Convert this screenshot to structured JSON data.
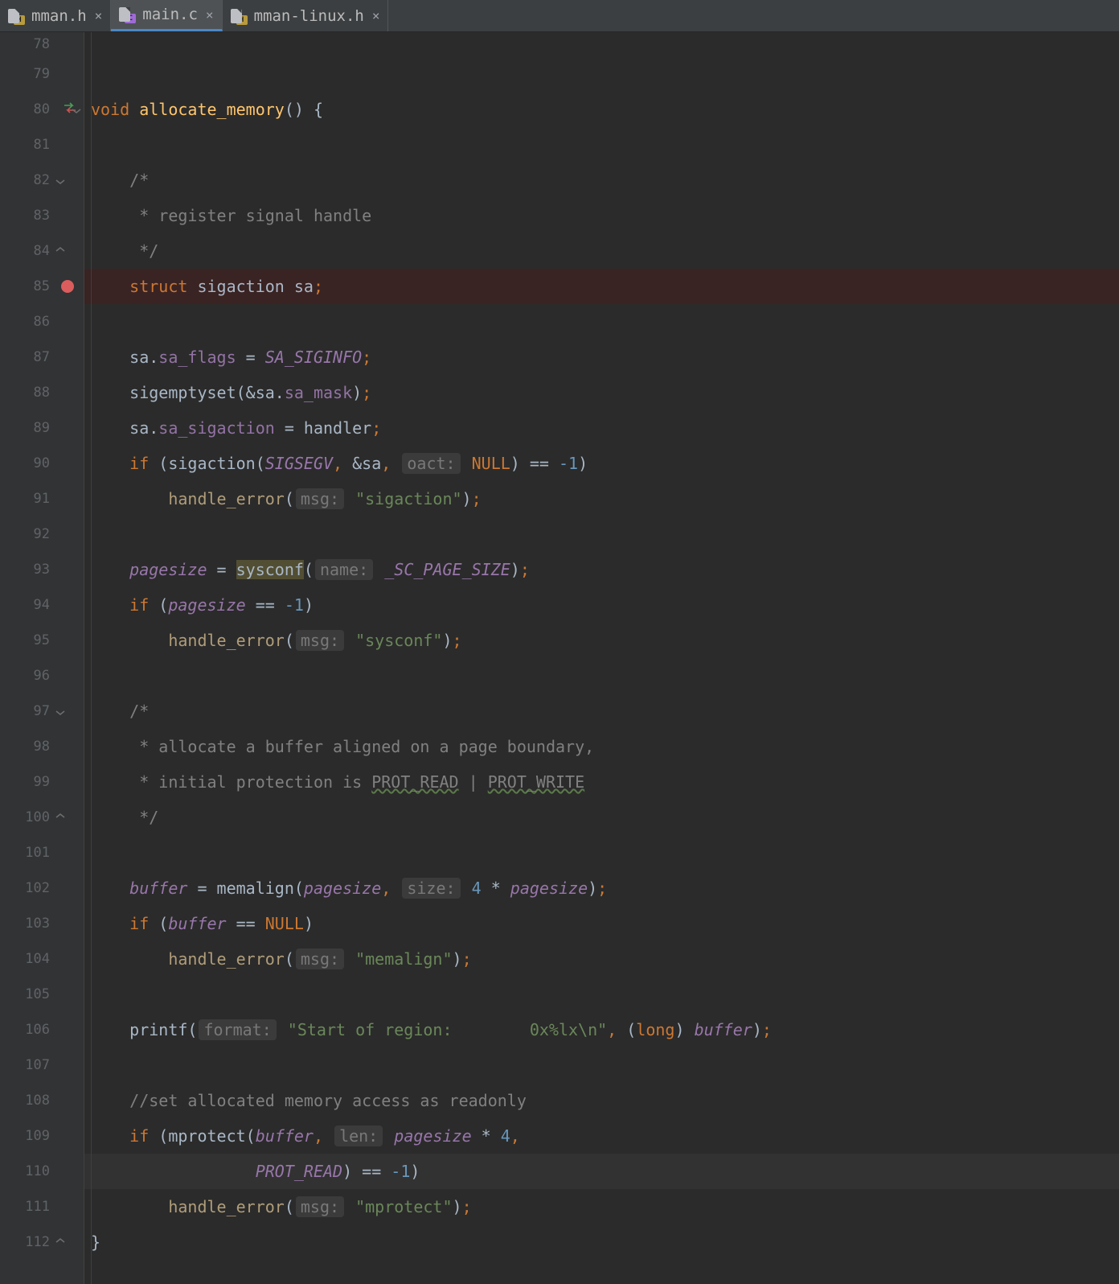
{
  "tabs": [
    {
      "label": "mman.h",
      "icon": "h",
      "active": false
    },
    {
      "label": "main.c",
      "icon": "c",
      "active": true
    },
    {
      "label": "mman-linux.h",
      "icon": "h",
      "active": false
    }
  ],
  "gutter": {
    "swap_line": 80,
    "breakpoint_line": 85,
    "fold_open_lines": [
      80,
      82,
      97
    ],
    "fold_close_lines": [
      84,
      100,
      112
    ]
  },
  "lines": [
    {
      "n": 78,
      "first": true,
      "tokens": []
    },
    {
      "n": 79,
      "tokens": []
    },
    {
      "n": 80,
      "tokens": [
        [
          "kw",
          "void "
        ],
        [
          "fn",
          "allocate_memory"
        ],
        [
          "id",
          "() {"
        ]
      ]
    },
    {
      "n": 81,
      "tokens": []
    },
    {
      "n": 82,
      "tokens": [
        [
          "id",
          "    "
        ],
        [
          "cm",
          "/*"
        ]
      ]
    },
    {
      "n": 83,
      "tokens": [
        [
          "id",
          "     "
        ],
        [
          "cm",
          "* register signal handle"
        ]
      ]
    },
    {
      "n": 84,
      "tokens": [
        [
          "id",
          "     "
        ],
        [
          "cm",
          "*/"
        ]
      ]
    },
    {
      "n": 85,
      "bp": true,
      "tokens": [
        [
          "id",
          "    "
        ],
        [
          "kw",
          "struct "
        ],
        [
          "id",
          "sigaction sa"
        ],
        [
          "kw",
          ";"
        ]
      ]
    },
    {
      "n": 86,
      "tokens": []
    },
    {
      "n": 87,
      "tokens": [
        [
          "id",
          "    sa."
        ],
        [
          "fd",
          "sa_flags"
        ],
        [
          "id",
          " = "
        ],
        [
          "mac",
          "SA_SIGINFO"
        ],
        [
          "kw",
          ";"
        ]
      ]
    },
    {
      "n": 88,
      "tokens": [
        [
          "id",
          "    sigemptyset(&sa."
        ],
        [
          "fd",
          "sa_mask"
        ],
        [
          "id",
          ")"
        ],
        [
          "kw",
          ";"
        ]
      ]
    },
    {
      "n": 89,
      "tokens": [
        [
          "id",
          "    sa."
        ],
        [
          "fd",
          "sa_sigaction"
        ],
        [
          "id",
          " = handler"
        ],
        [
          "kw",
          ";"
        ]
      ]
    },
    {
      "n": 90,
      "tokens": [
        [
          "id",
          "    "
        ],
        [
          "kw",
          "if "
        ],
        [
          "id",
          "(sigaction("
        ],
        [
          "mac",
          "SIGSEGV"
        ],
        [
          "kw",
          ", "
        ],
        [
          "id",
          "&sa"
        ],
        [
          "kw",
          ", "
        ],
        [
          "hint",
          "oact:"
        ],
        [
          "kw",
          " NULL"
        ],
        [
          "id",
          ") == "
        ],
        [
          "nm",
          "-1"
        ],
        [
          "id",
          ")"
        ]
      ]
    },
    {
      "n": 91,
      "tokens": [
        [
          "id",
          "        "
        ],
        [
          "fn2",
          "handle_error"
        ],
        [
          "id",
          "("
        ],
        [
          "hint",
          "msg:"
        ],
        [
          "id",
          " "
        ],
        [
          "st",
          "\"sigaction\""
        ],
        [
          "id",
          ")"
        ],
        [
          "kw",
          ";"
        ]
      ]
    },
    {
      "n": 92,
      "tokens": []
    },
    {
      "n": 93,
      "tokens": [
        [
          "id",
          "    "
        ],
        [
          "pu",
          "pagesize"
        ],
        [
          "id",
          " = "
        ],
        [
          "hi",
          "sysconf"
        ],
        [
          "id",
          "("
        ],
        [
          "hint",
          "name:"
        ],
        [
          "id",
          " "
        ],
        [
          "mac",
          "_SC_PAGE_SIZE"
        ],
        [
          "id",
          ")"
        ],
        [
          "kw",
          ";"
        ]
      ]
    },
    {
      "n": 94,
      "tokens": [
        [
          "id",
          "    "
        ],
        [
          "kw",
          "if "
        ],
        [
          "id",
          "("
        ],
        [
          "pu",
          "pagesize"
        ],
        [
          "id",
          " == "
        ],
        [
          "nm",
          "-1"
        ],
        [
          "id",
          ")"
        ]
      ]
    },
    {
      "n": 95,
      "tokens": [
        [
          "id",
          "        "
        ],
        [
          "fn2",
          "handle_error"
        ],
        [
          "id",
          "("
        ],
        [
          "hint",
          "msg:"
        ],
        [
          "id",
          " "
        ],
        [
          "st",
          "\"sysconf\""
        ],
        [
          "id",
          ")"
        ],
        [
          "kw",
          ";"
        ]
      ]
    },
    {
      "n": 96,
      "tokens": []
    },
    {
      "n": 97,
      "tokens": [
        [
          "id",
          "    "
        ],
        [
          "cm",
          "/*"
        ]
      ]
    },
    {
      "n": 98,
      "tokens": [
        [
          "id",
          "     "
        ],
        [
          "cm",
          "* allocate a buffer aligned on a page boundary,"
        ]
      ]
    },
    {
      "n": 99,
      "tokens": [
        [
          "id",
          "     "
        ],
        [
          "cm",
          "* initial protection is "
        ],
        [
          "ulcm",
          "PROT_READ"
        ],
        [
          "cm",
          " | "
        ],
        [
          "ulcm",
          "PROT_WRITE"
        ]
      ]
    },
    {
      "n": 100,
      "tokens": [
        [
          "id",
          "     "
        ],
        [
          "cm",
          "*/"
        ]
      ]
    },
    {
      "n": 101,
      "tokens": []
    },
    {
      "n": 102,
      "tokens": [
        [
          "id",
          "    "
        ],
        [
          "pu",
          "buffer"
        ],
        [
          "id",
          " = memalign("
        ],
        [
          "pu",
          "pagesize"
        ],
        [
          "kw",
          ", "
        ],
        [
          "hint",
          "size:"
        ],
        [
          "id",
          " "
        ],
        [
          "nm",
          "4"
        ],
        [
          "id",
          " * "
        ],
        [
          "pu",
          "pagesize"
        ],
        [
          "id",
          ")"
        ],
        [
          "kw",
          ";"
        ]
      ]
    },
    {
      "n": 103,
      "tokens": [
        [
          "id",
          "    "
        ],
        [
          "kw",
          "if "
        ],
        [
          "id",
          "("
        ],
        [
          "pu",
          "buffer"
        ],
        [
          "id",
          " == "
        ],
        [
          "kw",
          "NULL"
        ],
        [
          "id",
          ")"
        ]
      ]
    },
    {
      "n": 104,
      "tokens": [
        [
          "id",
          "        "
        ],
        [
          "fn2",
          "handle_error"
        ],
        [
          "id",
          "("
        ],
        [
          "hint",
          "msg:"
        ],
        [
          "id",
          " "
        ],
        [
          "st",
          "\"memalign\""
        ],
        [
          "id",
          ")"
        ],
        [
          "kw",
          ";"
        ]
      ]
    },
    {
      "n": 105,
      "tokens": []
    },
    {
      "n": 106,
      "tokens": [
        [
          "id",
          "    printf("
        ],
        [
          "hint",
          "format:"
        ],
        [
          "id",
          " "
        ],
        [
          "st",
          "\"Start of region:        0x%lx\\n\""
        ],
        [
          "kw",
          ", "
        ],
        [
          "id",
          "("
        ],
        [
          "kw",
          "long"
        ],
        [
          "id",
          ") "
        ],
        [
          "pu",
          "buffer"
        ],
        [
          "id",
          ")"
        ],
        [
          "kw",
          ";"
        ]
      ]
    },
    {
      "n": 107,
      "tokens": []
    },
    {
      "n": 108,
      "tokens": [
        [
          "id",
          "    "
        ],
        [
          "cm",
          "//set allocated memory access as readonly"
        ]
      ]
    },
    {
      "n": 109,
      "tokens": [
        [
          "id",
          "    "
        ],
        [
          "kw",
          "if "
        ],
        [
          "id",
          "(mprotect("
        ],
        [
          "pu",
          "buffer"
        ],
        [
          "kw",
          ", "
        ],
        [
          "hint",
          "len:"
        ],
        [
          "id",
          " "
        ],
        [
          "pu",
          "pagesize"
        ],
        [
          "id",
          " * "
        ],
        [
          "nm",
          "4"
        ],
        [
          "kw",
          ","
        ]
      ]
    },
    {
      "n": 110,
      "caret": true,
      "tokens": [
        [
          "id",
          "                 "
        ],
        [
          "mac",
          "PROT_READ"
        ],
        [
          "id",
          ") == "
        ],
        [
          "nm",
          "-1"
        ],
        [
          "id",
          ")"
        ]
      ]
    },
    {
      "n": 111,
      "tokens": [
        [
          "id",
          "        "
        ],
        [
          "fn2",
          "handle_error"
        ],
        [
          "id",
          "("
        ],
        [
          "hint",
          "msg:"
        ],
        [
          "id",
          " "
        ],
        [
          "st",
          "\"mprotect\""
        ],
        [
          "id",
          ")"
        ],
        [
          "kw",
          ";"
        ]
      ]
    },
    {
      "n": 112,
      "tokens": [
        [
          "id",
          "}"
        ]
      ]
    }
  ]
}
